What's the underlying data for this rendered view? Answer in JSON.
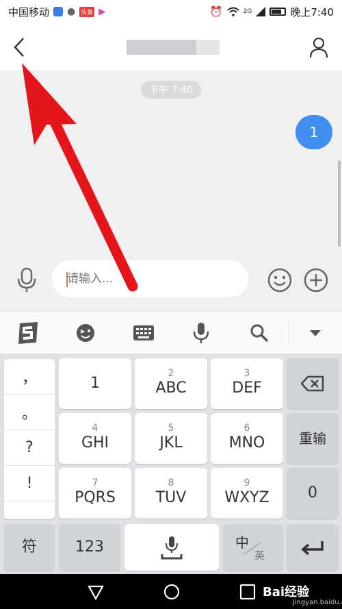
{
  "status_bar": {
    "carrier": "中国移动",
    "app_badge": "头条",
    "network": "2G",
    "time": "晚上7:40"
  },
  "chat": {
    "time_chip": "下午 7:40",
    "bubble_text": "1"
  },
  "input": {
    "placeholder": "请输入..."
  },
  "keyboard": {
    "punct": [
      "，",
      "。",
      "?",
      "!"
    ],
    "rows": [
      [
        {
          "num": "",
          "main": "1"
        },
        {
          "num": "2",
          "main": "ABC"
        },
        {
          "num": "3",
          "main": "DEF"
        }
      ],
      [
        {
          "num": "4",
          "main": "GHI"
        },
        {
          "num": "5",
          "main": "JKL"
        },
        {
          "num": "6",
          "main": "MNO"
        }
      ],
      [
        {
          "num": "7",
          "main": "PQRS"
        },
        {
          "num": "8",
          "main": "TUV"
        },
        {
          "num": "9",
          "main": "WXYZ"
        }
      ]
    ],
    "reinput": "重输",
    "zero": "0",
    "symbol": "符",
    "num_switch": "123",
    "lang_main": "中",
    "lang_sub": "英"
  },
  "navbar": {
    "watermark": "Bai经验",
    "watermark_sub": "jingyan.baidu.com"
  },
  "colors": {
    "accent": "#3f8ef0",
    "annotation": "#e5161b"
  }
}
